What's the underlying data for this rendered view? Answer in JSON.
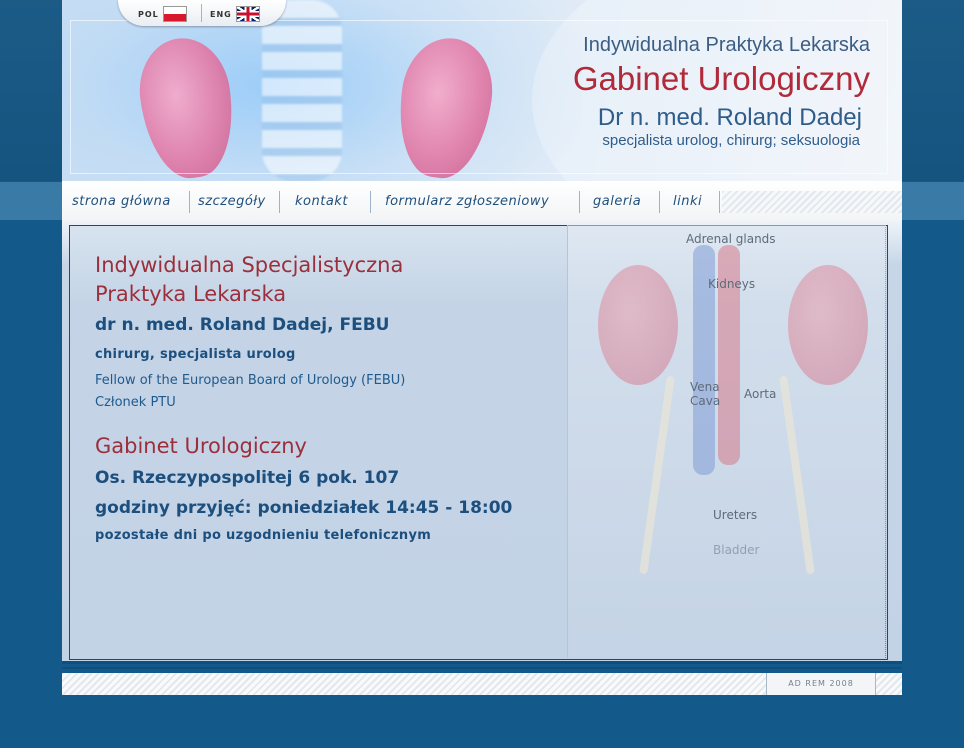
{
  "header": {
    "line1": "Indywidualna Praktyka Lekarska",
    "line2": "Gabinet Urologiczny",
    "line3": "Dr n. med. Roland Dadej",
    "line4": "specjalista urolog, chirurg; seksuologia"
  },
  "languages": {
    "pol": "POL",
    "eng": "ENG"
  },
  "nav": {
    "items": [
      "strona główna",
      "szczegóły",
      "kontakt",
      "formularz zgłoszeniowy",
      "galeria",
      "linki"
    ]
  },
  "main": {
    "heading": "Indywidualna Specjalistyczna Praktyka Lekarska",
    "heading_line1": "Indywidualna Specjalistyczna",
    "heading_line2": "Praktyka Lekarska",
    "doctor": "dr n. med. Roland Dadej, FEBU",
    "specialty": "chirurg, specjalista urolog",
    "fellow": "Fellow of the European Board of Urology (FEBU)",
    "member": "Członek PTU",
    "clinic_heading": "Gabinet Urologiczny",
    "address": "Os. Rzeczypospolitej 6 pok. 107",
    "hours": "godziny przyjęć: poniedziałek 14:45 - 18:00",
    "other_days": "pozostałe dni po uzgodnieniu telefonicznym"
  },
  "anatomy": {
    "labels": {
      "adrenal": "Adrenal glands",
      "kidneys": "Kidneys",
      "vena": "Vena",
      "cava": "Cava",
      "aorta": "Aorta",
      "ureters": "Ureters",
      "bladder": "Bladder"
    }
  },
  "footer": {
    "copyright": "AD REM 2008"
  },
  "colors": {
    "background": "#135a8a",
    "heading_red": "#9b2f3b",
    "text_blue": "#1c4f7e",
    "nav_text": "#21507d"
  }
}
